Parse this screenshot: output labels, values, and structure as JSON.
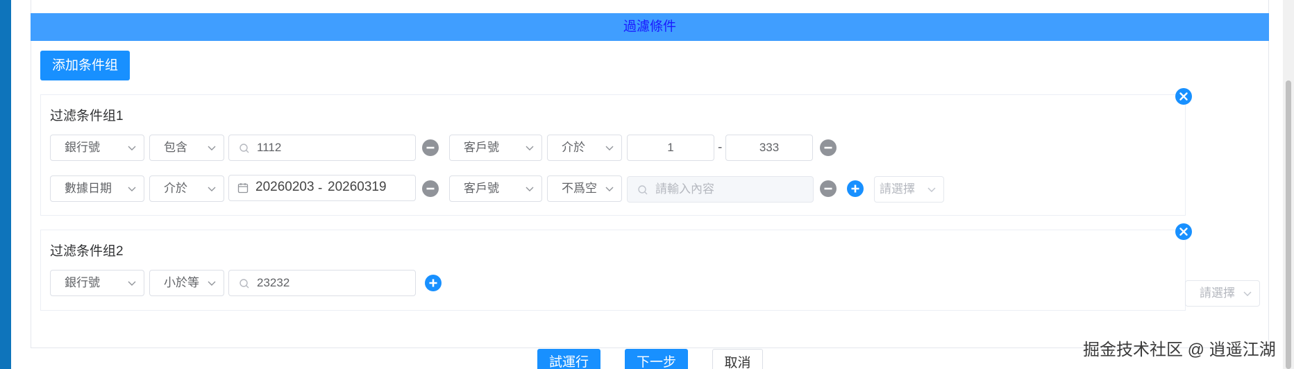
{
  "filter_header": {
    "title": "過濾條件"
  },
  "add_group_button": {
    "label": "添加条件组"
  },
  "groups": [
    {
      "title": "过滤条件组1",
      "rows": [
        {
          "left": {
            "field": "銀行號",
            "operator": "包含",
            "value": "1112"
          },
          "right": {
            "field": "客戶號",
            "operator": "介於",
            "range_from": "1",
            "range_separator": "-",
            "range_to": "333"
          }
        },
        {
          "left": {
            "field": "數據日期",
            "operator": "介於",
            "date_from": "20260203",
            "date_separator": "-",
            "date_to": "20260319"
          },
          "right": {
            "field": "客戶號",
            "operator": "不爲空",
            "value_placeholder": "請輸入內容",
            "extra_select_placeholder": "請選擇"
          }
        }
      ]
    },
    {
      "title": "过滤条件组2",
      "rows": [
        {
          "left": {
            "field": "銀行號",
            "operator": "小於等",
            "value": "23232"
          }
        }
      ]
    }
  ],
  "floating_select": {
    "placeholder": "請選擇"
  },
  "footer": {
    "run_label": "試運行",
    "next_label": "下一步",
    "cancel_label": "取消"
  },
  "watermark": "掘金技术社区 @ 逍遥江湖",
  "colors": {
    "primary": "#1890ff",
    "header_bg": "#409eff",
    "header_text": "#1a1aff",
    "remove_icon": "#909399",
    "danger": "#1890ff"
  },
  "icons": {
    "remove_condition": "minus-circle-icon",
    "add_condition": "plus-circle-icon",
    "remove_group": "close-circle-icon",
    "search": "search-icon",
    "calendar": "calendar-icon",
    "dropdown": "chevron-down-icon"
  }
}
